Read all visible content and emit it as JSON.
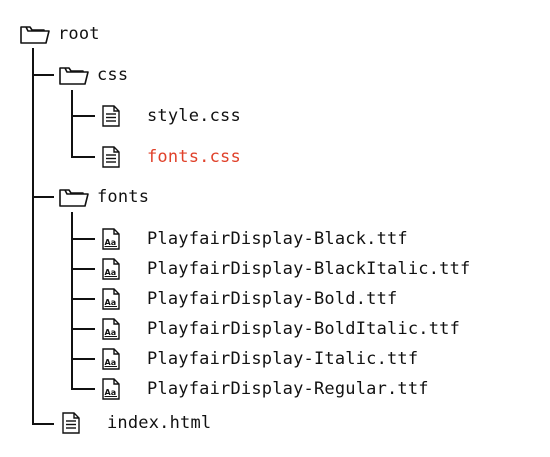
{
  "tree": {
    "root": {
      "label": "root",
      "icon": "folder-icon"
    },
    "css": {
      "label": "css",
      "icon": "folder-icon",
      "files": [
        {
          "label": "style.css",
          "icon": "file-text-icon",
          "highlight": false
        },
        {
          "label": "fonts.css",
          "icon": "file-text-icon",
          "highlight": true
        }
      ]
    },
    "fonts": {
      "label": "fonts",
      "icon": "folder-icon",
      "files": [
        {
          "label": "PlayfairDisplay-Black.ttf",
          "icon": "font-file-icon"
        },
        {
          "label": "PlayfairDisplay-BlackItalic.ttf",
          "icon": "font-file-icon"
        },
        {
          "label": "PlayfairDisplay-Bold.ttf",
          "icon": "font-file-icon"
        },
        {
          "label": "PlayfairDisplay-BoldItalic.ttf",
          "icon": "font-file-icon"
        },
        {
          "label": "PlayfairDisplay-Italic.ttf",
          "icon": "font-file-icon"
        },
        {
          "label": "PlayfairDisplay-Regular.ttf",
          "icon": "font-file-icon"
        }
      ]
    },
    "index": {
      "label": "index.html",
      "icon": "file-text-icon"
    }
  },
  "colors": {
    "line": "#111111",
    "highlight": "#e0412a"
  }
}
